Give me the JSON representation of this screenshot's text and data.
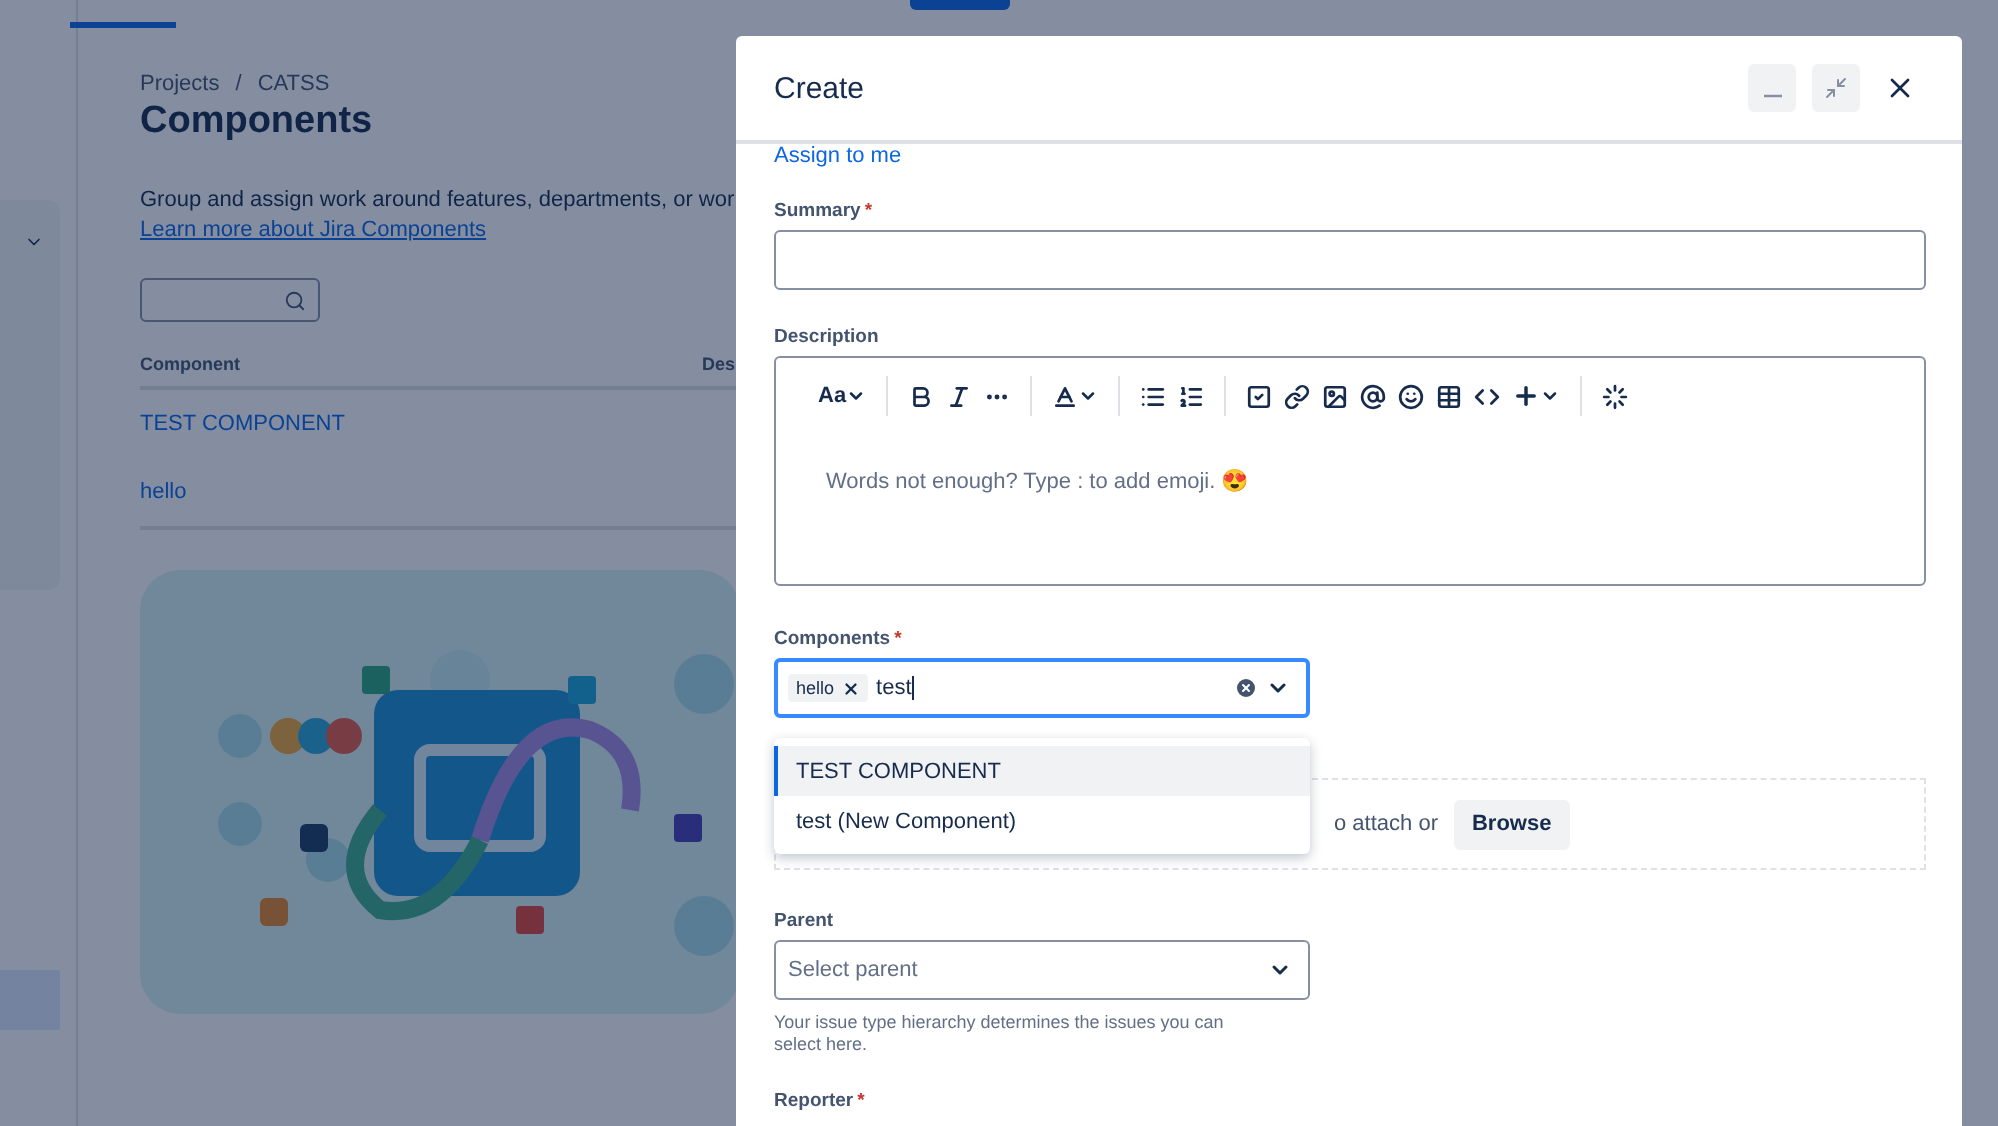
{
  "page": {
    "breadcrumbs": [
      {
        "label": "Projects",
        "separator": "/"
      },
      {
        "label": "CATSS"
      }
    ],
    "title": "Components",
    "description": "Group and assign work around features, departments, or wor",
    "learn_link": "Learn more about Jira Components",
    "table": {
      "columns": [
        "Component",
        "Des"
      ],
      "rows": [
        {
          "name": "TEST COMPONENT"
        },
        {
          "name": "hello"
        }
      ]
    }
  },
  "modal": {
    "title": "Create",
    "assign_link": "Assign to me",
    "summary": {
      "label": "Summary",
      "required_mark": "*"
    },
    "description": {
      "label": "Description",
      "text_style": "Aa",
      "placeholder": "Words not enough? Type : to add emoji. 😍"
    },
    "components": {
      "label": "Components",
      "required_mark": "*",
      "tags": [
        "hello"
      ],
      "value": "test",
      "options": [
        {
          "label": "TEST COMPONENT",
          "selected": true
        },
        {
          "label": "test (New Component)",
          "selected": false
        }
      ]
    },
    "attachment": {
      "text": "o attach or",
      "button": "Browse"
    },
    "parent": {
      "label": "Parent",
      "placeholder": "Select parent",
      "help": "Your issue type hierarchy determines the issues you can select here."
    },
    "reporter": {
      "label": "Reporter",
      "required_mark": "*"
    }
  }
}
